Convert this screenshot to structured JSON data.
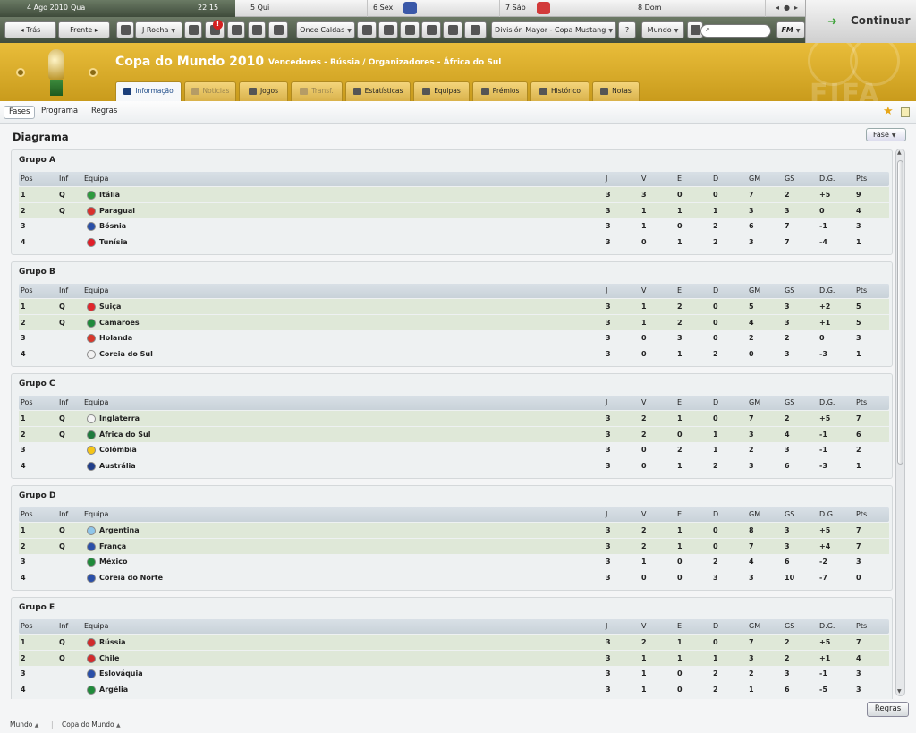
{
  "calendar": {
    "date": "4 Ago 2010",
    "weekday": "Qua",
    "time": "22:15",
    "days": [
      "5 Qui",
      "6 Sex",
      "7 Sáb",
      "8 Dom"
    ]
  },
  "toolbar": {
    "back": "Trás",
    "forward": "Frente",
    "manager": "J Rocha",
    "inbox_badge": "!",
    "club": "Once Caldas",
    "competition": "División Mayor - Copa Mustang",
    "world": "Mundo",
    "fm": "FM",
    "continue": "Continuar"
  },
  "header": {
    "title": "Copa do Mundo 2010",
    "subtitle": "Vencedores - Rússia / Organizadores - África do Sul",
    "watermark": "FIFA"
  },
  "tabs": [
    {
      "label": "Informação",
      "active": true
    },
    {
      "label": "Notícias",
      "dim": true
    },
    {
      "label": "Jogos"
    },
    {
      "label": "Transf.",
      "dim": true
    },
    {
      "label": "Estatísticas"
    },
    {
      "label": "Equipas"
    },
    {
      "label": "Prémios"
    },
    {
      "label": "Histórico"
    },
    {
      "label": "Notas"
    }
  ],
  "subtabs": [
    "Fases",
    "Programa",
    "Regras"
  ],
  "page": {
    "heading": "Diagrama",
    "phase_button": "Fase"
  },
  "table_headers": [
    "Pos",
    "Inf",
    "Equipa",
    "J",
    "V",
    "E",
    "D",
    "GM",
    "GS",
    "D.G.",
    "Pts"
  ],
  "groups": [
    {
      "name": "Grupo A",
      "rows": [
        {
          "pos": "1",
          "inf": "Q",
          "team": "Itália",
          "j": "3",
          "v": "3",
          "e": "0",
          "d": "0",
          "gm": "7",
          "gs": "2",
          "dg": "+5",
          "pts": "9"
        },
        {
          "pos": "2",
          "inf": "Q",
          "team": "Paraguai",
          "j": "3",
          "v": "1",
          "e": "1",
          "d": "1",
          "gm": "3",
          "gs": "3",
          "dg": "0",
          "pts": "4"
        },
        {
          "pos": "3",
          "inf": "",
          "team": "Bósnia",
          "j": "3",
          "v": "1",
          "e": "0",
          "d": "2",
          "gm": "6",
          "gs": "7",
          "dg": "-1",
          "pts": "3"
        },
        {
          "pos": "4",
          "inf": "",
          "team": "Tunísia",
          "j": "3",
          "v": "0",
          "e": "1",
          "d": "2",
          "gm": "3",
          "gs": "7",
          "dg": "-4",
          "pts": "1"
        }
      ]
    },
    {
      "name": "Grupo B",
      "rows": [
        {
          "pos": "1",
          "inf": "Q",
          "team": "Suiça",
          "j": "3",
          "v": "1",
          "e": "2",
          "d": "0",
          "gm": "5",
          "gs": "3",
          "dg": "+2",
          "pts": "5"
        },
        {
          "pos": "2",
          "inf": "Q",
          "team": "Camarões",
          "j": "3",
          "v": "1",
          "e": "2",
          "d": "0",
          "gm": "4",
          "gs": "3",
          "dg": "+1",
          "pts": "5"
        },
        {
          "pos": "3",
          "inf": "",
          "team": "Holanda",
          "j": "3",
          "v": "0",
          "e": "3",
          "d": "0",
          "gm": "2",
          "gs": "2",
          "dg": "0",
          "pts": "3"
        },
        {
          "pos": "4",
          "inf": "",
          "team": "Coreia do Sul",
          "j": "3",
          "v": "0",
          "e": "1",
          "d": "2",
          "gm": "0",
          "gs": "3",
          "dg": "-3",
          "pts": "1"
        }
      ]
    },
    {
      "name": "Grupo C",
      "rows": [
        {
          "pos": "1",
          "inf": "Q",
          "team": "Inglaterra",
          "j": "3",
          "v": "2",
          "e": "1",
          "d": "0",
          "gm": "7",
          "gs": "2",
          "dg": "+5",
          "pts": "7"
        },
        {
          "pos": "2",
          "inf": "Q",
          "team": "África do Sul",
          "j": "3",
          "v": "2",
          "e": "0",
          "d": "1",
          "gm": "3",
          "gs": "4",
          "dg": "-1",
          "pts": "6"
        },
        {
          "pos": "3",
          "inf": "",
          "team": "Colômbia",
          "j": "3",
          "v": "0",
          "e": "2",
          "d": "1",
          "gm": "2",
          "gs": "3",
          "dg": "-1",
          "pts": "2"
        },
        {
          "pos": "4",
          "inf": "",
          "team": "Austrália",
          "j": "3",
          "v": "0",
          "e": "1",
          "d": "2",
          "gm": "3",
          "gs": "6",
          "dg": "-3",
          "pts": "1"
        }
      ]
    },
    {
      "name": "Grupo D",
      "rows": [
        {
          "pos": "1",
          "inf": "Q",
          "team": "Argentina",
          "j": "3",
          "v": "2",
          "e": "1",
          "d": "0",
          "gm": "8",
          "gs": "3",
          "dg": "+5",
          "pts": "7"
        },
        {
          "pos": "2",
          "inf": "Q",
          "team": "França",
          "j": "3",
          "v": "2",
          "e": "1",
          "d": "0",
          "gm": "7",
          "gs": "3",
          "dg": "+4",
          "pts": "7"
        },
        {
          "pos": "3",
          "inf": "",
          "team": "México",
          "j": "3",
          "v": "1",
          "e": "0",
          "d": "2",
          "gm": "4",
          "gs": "6",
          "dg": "-2",
          "pts": "3"
        },
        {
          "pos": "4",
          "inf": "",
          "team": "Coreia do Norte",
          "j": "3",
          "v": "0",
          "e": "0",
          "d": "3",
          "gm": "3",
          "gs": "10",
          "dg": "-7",
          "pts": "0"
        }
      ]
    },
    {
      "name": "Grupo E",
      "rows": [
        {
          "pos": "1",
          "inf": "Q",
          "team": "Rússia",
          "j": "3",
          "v": "2",
          "e": "1",
          "d": "0",
          "gm": "7",
          "gs": "2",
          "dg": "+5",
          "pts": "7"
        },
        {
          "pos": "2",
          "inf": "Q",
          "team": "Chile",
          "j": "3",
          "v": "1",
          "e": "1",
          "d": "1",
          "gm": "3",
          "gs": "2",
          "dg": "+1",
          "pts": "4"
        },
        {
          "pos": "3",
          "inf": "",
          "team": "Eslováquia",
          "j": "3",
          "v": "1",
          "e": "0",
          "d": "2",
          "gm": "2",
          "gs": "3",
          "dg": "-1",
          "pts": "3"
        },
        {
          "pos": "4",
          "inf": "",
          "team": "Argélia",
          "j": "3",
          "v": "1",
          "e": "0",
          "d": "2",
          "gm": "1",
          "gs": "6",
          "dg": "-5",
          "pts": "3"
        }
      ]
    }
  ],
  "flag_colors": {
    "Itália": "#2e9a3e",
    "Paraguai": "#d9302c",
    "Bósnia": "#2a4fa8",
    "Tunísia": "#e01e28",
    "Suiça": "#e0262c",
    "Camarões": "#1f8a3a",
    "Holanda": "#d8382c",
    "Coreia do Sul": "#f2f2f2",
    "Inglaterra": "#f4f4f4",
    "África do Sul": "#1e7a3c",
    "Colômbia": "#f5c518",
    "Austrália": "#1f3d8a",
    "Argentina": "#8ec6ea",
    "França": "#2a4fa8",
    "México": "#1f8a3a",
    "Coreia do Norte": "#2a4fa8",
    "Rússia": "#d12a2a",
    "Chile": "#d22c2c",
    "Eslováquia": "#2a4fa8",
    "Argélia": "#1f8a3a"
  },
  "footer": {
    "regras_button": "Regras",
    "crumbs": [
      "Mundo",
      "Copa do Mundo"
    ]
  }
}
